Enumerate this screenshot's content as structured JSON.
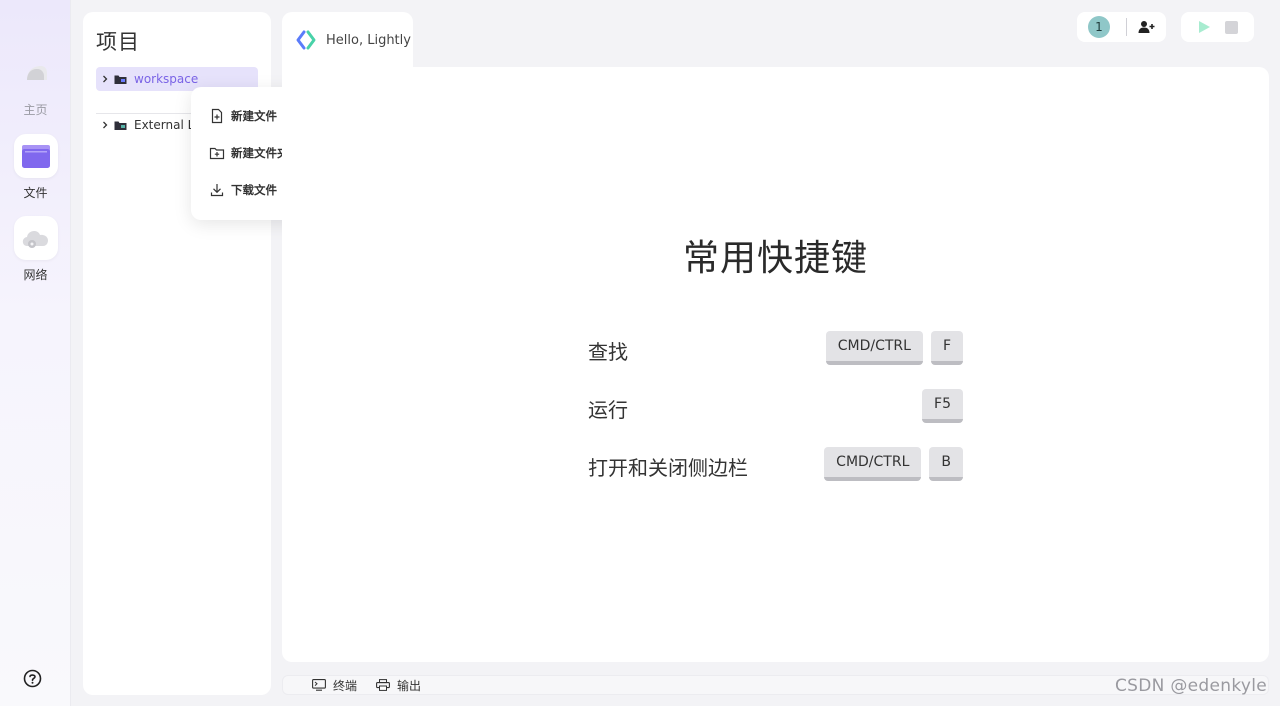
{
  "nav": {
    "items": [
      {
        "label": "主页",
        "icon": "home-icon"
      },
      {
        "label": "文件",
        "icon": "folder-icon",
        "active": true
      },
      {
        "label": "网络",
        "icon": "cloud-network-icon"
      }
    ],
    "help_icon": "help-circle-icon"
  },
  "project": {
    "title": "项目",
    "tree": [
      {
        "label": "workspace",
        "selected": true
      },
      {
        "label": "External Li"
      }
    ]
  },
  "context_menu": {
    "items": [
      {
        "label": "新建文件",
        "icon": "new-file-icon"
      },
      {
        "label": "新建文件夹",
        "icon": "new-folder-icon"
      },
      {
        "label": "下载文件",
        "icon": "download-icon"
      }
    ]
  },
  "tab": {
    "label": "Hello, Lightly"
  },
  "collab": {
    "user_count": "1"
  },
  "shortcuts": {
    "title": "常用快捷键",
    "rows": [
      {
        "label": "查找",
        "keys": [
          "CMD/CTRL",
          "F"
        ]
      },
      {
        "label": "运行",
        "keys": [
          "F5"
        ]
      },
      {
        "label": "打开和关闭侧边栏",
        "keys": [
          "CMD/CTRL",
          "B"
        ]
      }
    ]
  },
  "bottom": {
    "terminal": "终端",
    "output": "输出"
  },
  "watermark": "CSDN @edenkyle",
  "colors": {
    "accent": "#7a63e6",
    "selected_bg": "#e6e2fb",
    "run_green": "#a8ecd0",
    "badge": "#8fc7c8"
  }
}
